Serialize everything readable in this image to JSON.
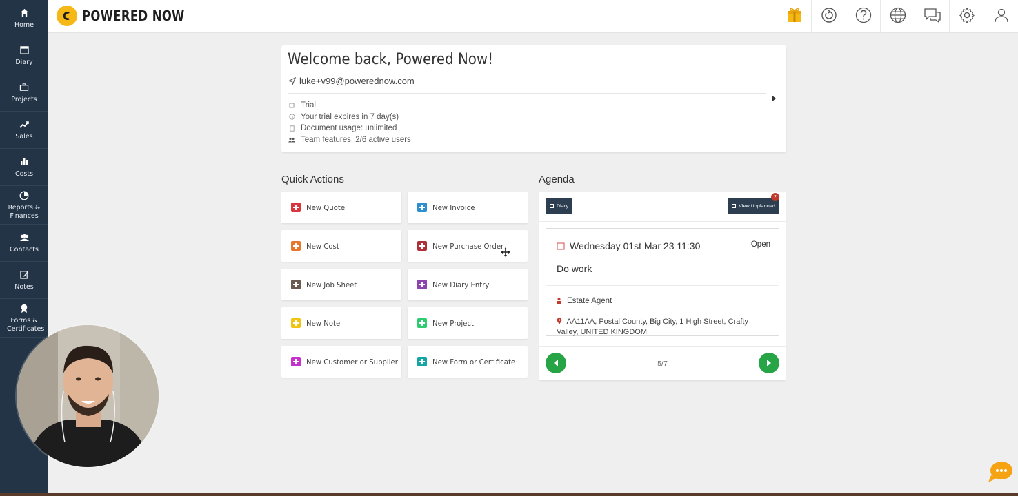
{
  "app": {
    "brand_name": "POWERED NOW",
    "brand_color": "#f5b815",
    "sidebar_color": "#243447",
    "accent_green": "#27a546"
  },
  "sidebar": {
    "items": [
      {
        "label": "Home",
        "icon": "home-icon"
      },
      {
        "label": "Diary",
        "icon": "calendar-icon"
      },
      {
        "label": "Projects",
        "icon": "briefcase-icon"
      },
      {
        "label": "Sales",
        "icon": "trending-up-icon"
      },
      {
        "label": "Costs",
        "icon": "bar-chart-icon"
      },
      {
        "label": "Reports & Finances",
        "icon": "pie-chart-icon"
      },
      {
        "label": "Contacts",
        "icon": "users-icon"
      },
      {
        "label": "Notes",
        "icon": "pencil-icon"
      },
      {
        "label": "Forms & Certificates",
        "icon": "award-icon"
      }
    ]
  },
  "topbar": {
    "icons": [
      "gift-icon",
      "refresh-icon",
      "help-icon",
      "globe-icon",
      "chat-icon",
      "gear-icon",
      "user-icon"
    ]
  },
  "welcome": {
    "title": "Welcome back, Powered Now!",
    "email": "luke+v99@powerednow.com",
    "info": [
      {
        "icon": "tag-icon",
        "text": "Trial"
      },
      {
        "icon": "clock-icon",
        "text": "Your trial expires in 7 day(s)"
      },
      {
        "icon": "document-icon",
        "text": "Document usage: unlimited"
      },
      {
        "icon": "team-icon",
        "text": "Team features: 2/6 active users"
      }
    ]
  },
  "quick_actions": {
    "title": "Quick Actions",
    "items": [
      {
        "label": "New Quote",
        "color": "#d9363e"
      },
      {
        "label": "New Invoice",
        "color": "#2b8fd0"
      },
      {
        "label": "New Cost",
        "color": "#e8762b"
      },
      {
        "label": "New Purchase Order",
        "color": "#b0303a"
      },
      {
        "label": "New Job Sheet",
        "color": "#6b5b50"
      },
      {
        "label": "New Diary Entry",
        "color": "#8e44ad"
      },
      {
        "label": "New Note",
        "color": "#f1c40f"
      },
      {
        "label": "New Project",
        "color": "#2ecc71"
      },
      {
        "label": "New Customer or Supplier",
        "color": "#c62fd0"
      },
      {
        "label": "New Form or Certificate",
        "color": "#16a5a5"
      }
    ]
  },
  "agenda": {
    "title": "Agenda",
    "diary_button": "Diary",
    "unplanned_button": "View Unplanned",
    "unplanned_count": "2",
    "event": {
      "date": "Wednesday 01st Mar 23 11:30",
      "status": "Open",
      "title": "Do work",
      "contact": "Estate Agent",
      "address": "AA11AA, Postal County, Big City, 1 High Street, Crafty Valley, UNITED KINGDOM"
    },
    "pager": "5/7"
  }
}
